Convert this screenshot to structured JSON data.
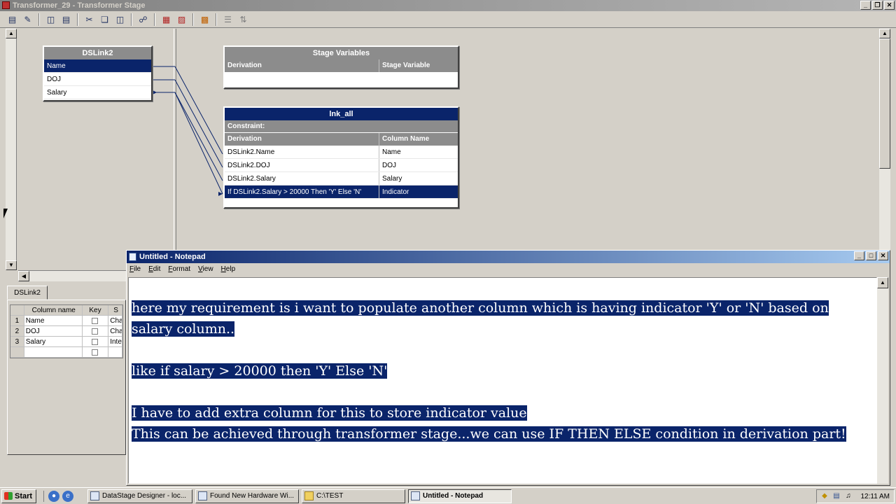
{
  "window": {
    "title": "Transformer_29 - Transformer Stage",
    "controls": [
      "_",
      "❐",
      "✕"
    ]
  },
  "toolbar": {
    "buttons": [
      "stage-properties-icon",
      "constraints-icon",
      "show-all-icon",
      "show-relations-icon",
      "cut-icon",
      "copy-icon",
      "paste-icon",
      "find-replace-icon",
      "load-columns-icon",
      "save-columns-icon",
      "column-automatch-icon",
      "input-link-order-icon",
      "output-link-order-icon"
    ]
  },
  "input_link": {
    "title": "DSLink2",
    "columns": [
      "Name",
      "DOJ",
      "Salary"
    ],
    "selected_index": 0
  },
  "stage_variables": {
    "title": "Stage Variables",
    "headers": [
      "Derivation",
      "Stage Variable"
    ]
  },
  "output_link": {
    "title": "lnk_all",
    "constraint_label": "Constraint:",
    "headers": [
      "Derivation",
      "Column Name"
    ],
    "rows": [
      {
        "derivation": "DSLink2.Name",
        "column": "Name"
      },
      {
        "derivation": "DSLink2.DOJ",
        "column": "DOJ"
      },
      {
        "derivation": "DSLink2.Salary",
        "column": "Salary"
      },
      {
        "derivation": "If DSLink2.Salary > 20000 Then 'Y' Else 'N'",
        "column": "Indicator"
      }
    ],
    "selected_index": 3
  },
  "meta_panel": {
    "tab": "DSLink2",
    "headers": [
      "",
      "Column name",
      "Key",
      "S"
    ],
    "rows": [
      {
        "n": "1",
        "name": "Name",
        "sql": "Cha"
      },
      {
        "n": "2",
        "name": "DOJ",
        "sql": "Cha"
      },
      {
        "n": "3",
        "name": "Salary",
        "sql": "Inte"
      },
      {
        "n": "",
        "name": "",
        "sql": ""
      }
    ]
  },
  "notepad": {
    "title": "Untitled - Notepad",
    "menu": [
      "File",
      "Edit",
      "Format",
      "View",
      "Help"
    ],
    "lines": [
      "here my requirement is i want to populate another column which is having indicator 'Y' or 'N' based on",
      "salary column..",
      "",
      "like if salary > 20000 then 'Y' Else 'N'",
      "",
      "I have to add extra column for this to store indicator value",
      "This can be achieved through transformer stage...we can use IF THEN ELSE condition in derivation part!"
    ]
  },
  "taskbar": {
    "start_label": "Start",
    "tasks": [
      {
        "label": "DataStage Designer - loc...",
        "active": false
      },
      {
        "label": "Found New Hardware Wi...",
        "active": false
      },
      {
        "label": "C:\\TEST",
        "active": false
      },
      {
        "label": "Untitled - Notepad",
        "active": true
      }
    ],
    "clock": "12:11 AM"
  }
}
